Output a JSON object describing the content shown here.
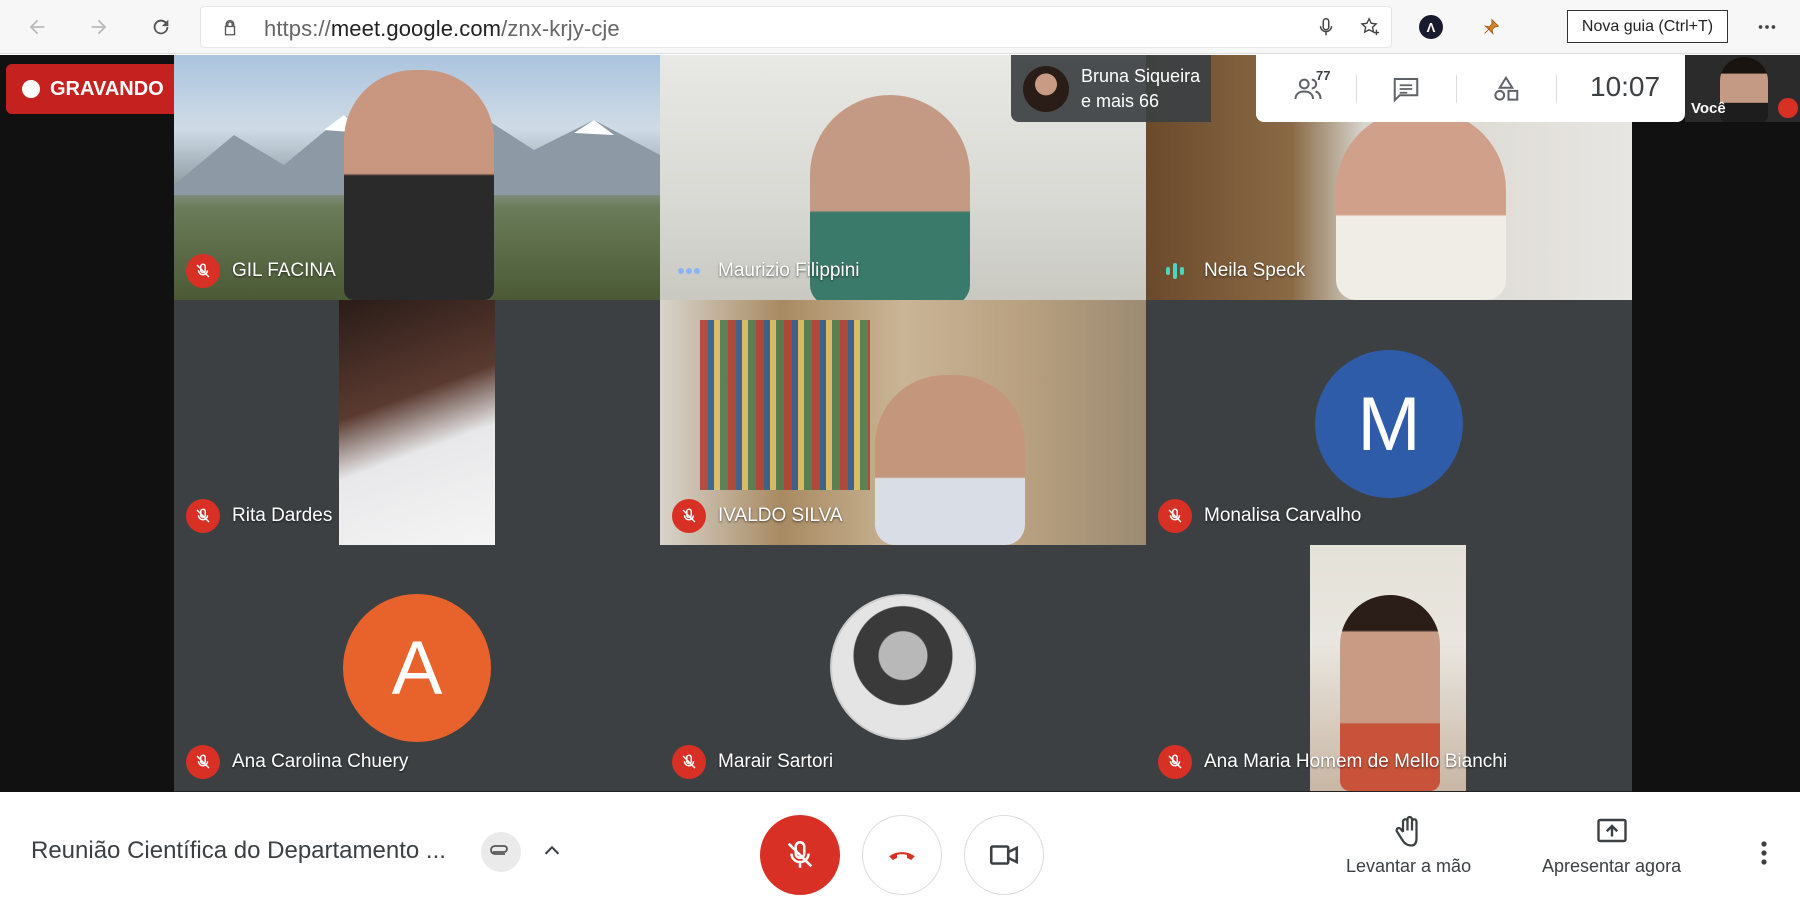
{
  "browser": {
    "url_prefix": "https://",
    "url_host": "meet.google.com",
    "url_path": "/znx-krjy-cje",
    "tooltip": "Nova guia (Ctrl+T)"
  },
  "recording": {
    "label": "GRAVANDO"
  },
  "presenter": {
    "name": "Bruna Siqueira",
    "others": "e mais 66"
  },
  "info": {
    "people_count": "77",
    "time": "10:07"
  },
  "self": {
    "label": "Você"
  },
  "tiles": [
    {
      "name": "GIL FACINA",
      "status": "muted"
    },
    {
      "name": "Maurizio Filippini",
      "status": "dots"
    },
    {
      "name": "Neila Speck",
      "status": "speaking"
    },
    {
      "name": "Rita Dardes",
      "status": "muted"
    },
    {
      "name": "IVALDO SILVA",
      "status": "muted"
    },
    {
      "name": "Monalisa Carvalho",
      "status": "muted",
      "avatar_letter": "M",
      "avatar_color": "#2f5ca8"
    },
    {
      "name": "Ana Carolina Chuery",
      "status": "muted",
      "avatar_letter": "A",
      "avatar_color": "#e8632b"
    },
    {
      "name": "Marair Sartori",
      "status": "muted"
    },
    {
      "name": "Ana Maria Homem de Mello Bianchi",
      "status": "muted"
    }
  ],
  "bottom": {
    "meeting_title": "Reunião Científica do Departamento ...",
    "raise_hand": "Levantar a mão",
    "present_now": "Apresentar agora"
  },
  "colors": {
    "accent_red": "#d93025",
    "stage_bg": "#202124"
  }
}
